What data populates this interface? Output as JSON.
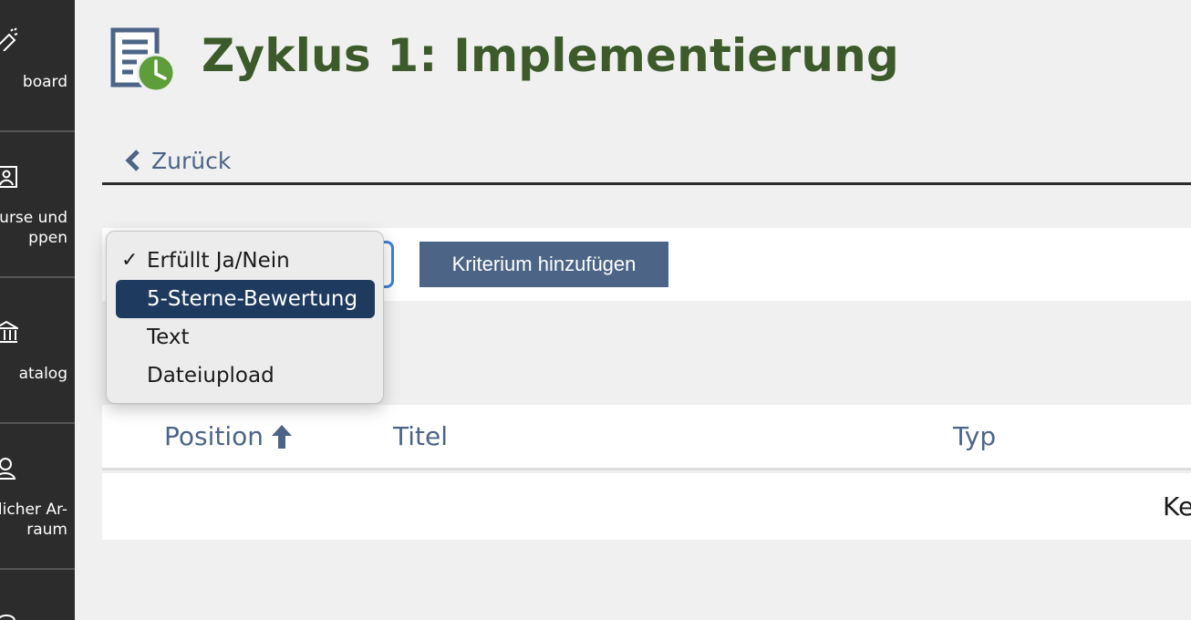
{
  "sidebar": {
    "items": [
      {
        "label": "board",
        "icon": "dashboard-icon"
      },
      {
        "label": "urse und\nppen",
        "icon": "courses-icon"
      },
      {
        "label": "atalog",
        "icon": "catalog-icon"
      },
      {
        "label": "licher Ar-\nraum",
        "icon": "workspace-icon"
      }
    ]
  },
  "header": {
    "title": "Zyklus 1: Implementierung",
    "icon": "assignment-clock-icon",
    "back_label": "Zurück"
  },
  "toolbar": {
    "add_label": "Kriterium hinzufügen"
  },
  "dropdown": {
    "options": [
      {
        "label": "Erfüllt Ja/Nein",
        "check": "✓",
        "checked": true,
        "highlighted": false
      },
      {
        "label": "5-Sterne-Bewertung",
        "check": "",
        "checked": false,
        "highlighted": true
      },
      {
        "label": "Text",
        "check": "",
        "checked": false,
        "highlighted": false
      },
      {
        "label": "Dateiupload",
        "check": "",
        "checked": false,
        "highlighted": false
      }
    ]
  },
  "table": {
    "columns": [
      "Position",
      "Titel",
      "Typ"
    ],
    "sort_icon": "arrow-up-icon",
    "empty_text": "Ke"
  },
  "colors": {
    "sidebar": "#2c2c2c",
    "title": "#3c5a2a",
    "accent": "#4c6586",
    "highlight": "#1e3a5f",
    "focus": "#3f7fd8"
  }
}
